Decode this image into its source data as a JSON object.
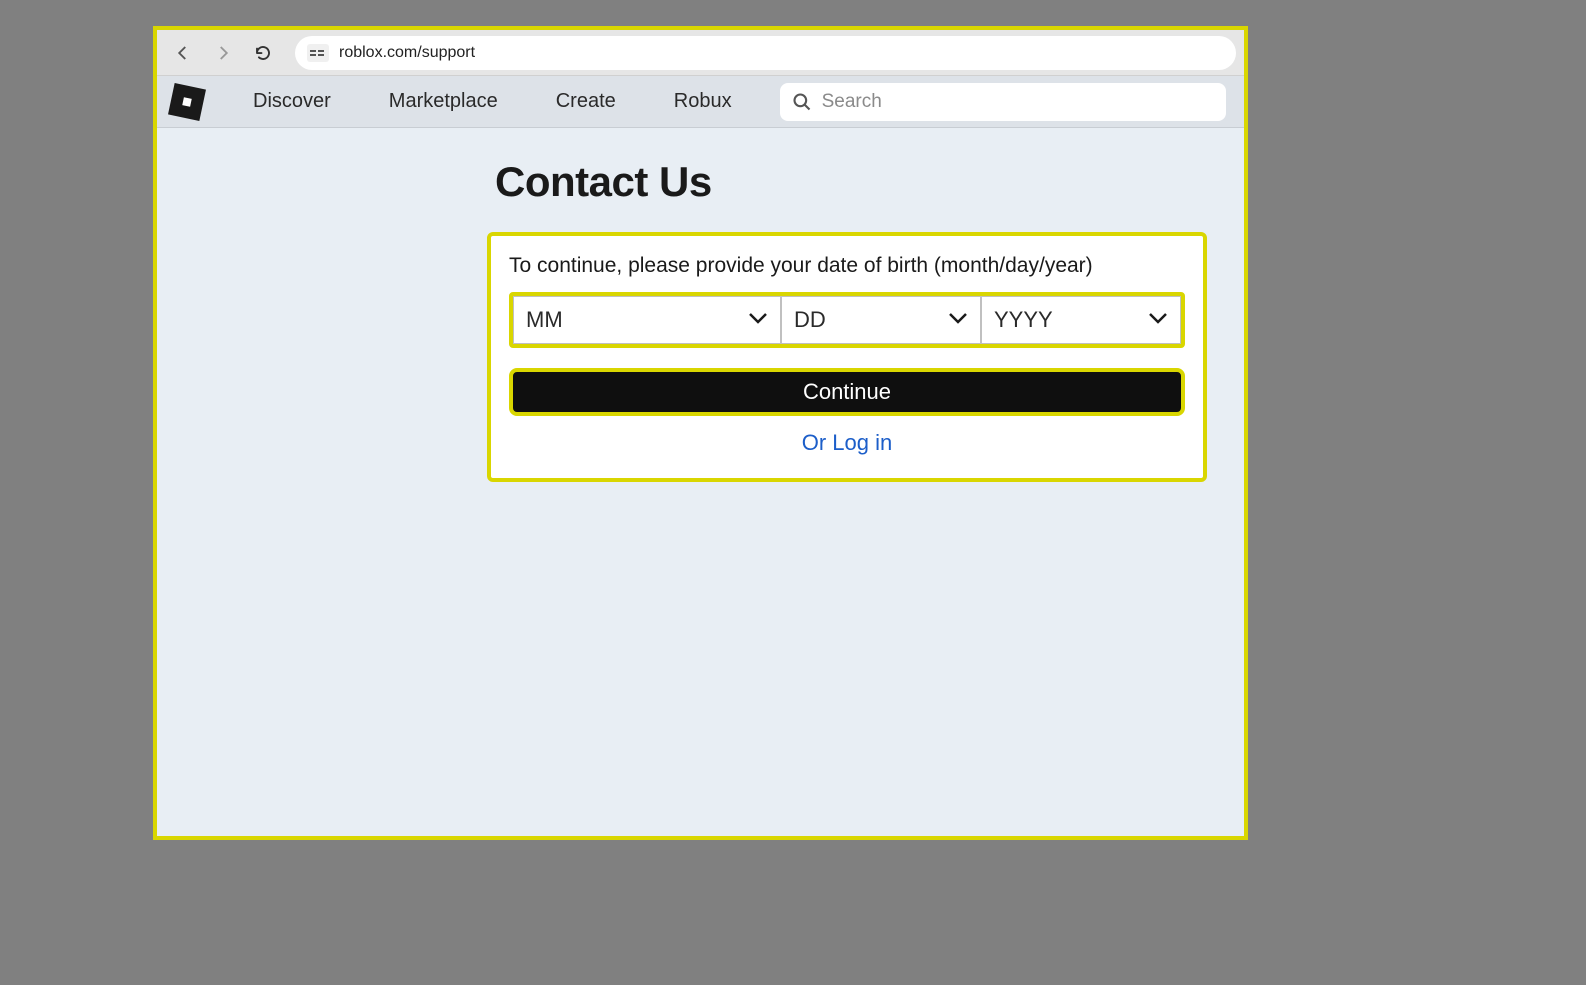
{
  "browser": {
    "url": "roblox.com/support"
  },
  "header": {
    "nav": {
      "discover": "Discover",
      "marketplace": "Marketplace",
      "create": "Create",
      "robux": "Robux"
    },
    "search": {
      "placeholder": "Search",
      "value": ""
    }
  },
  "page": {
    "title": "Contact Us"
  },
  "form": {
    "prompt": "To continue, please provide your date of birth (month/day/year)",
    "month_label": "MM",
    "day_label": "DD",
    "year_label": "YYYY",
    "continue_label": "Continue",
    "login_link": "Or Log in"
  }
}
